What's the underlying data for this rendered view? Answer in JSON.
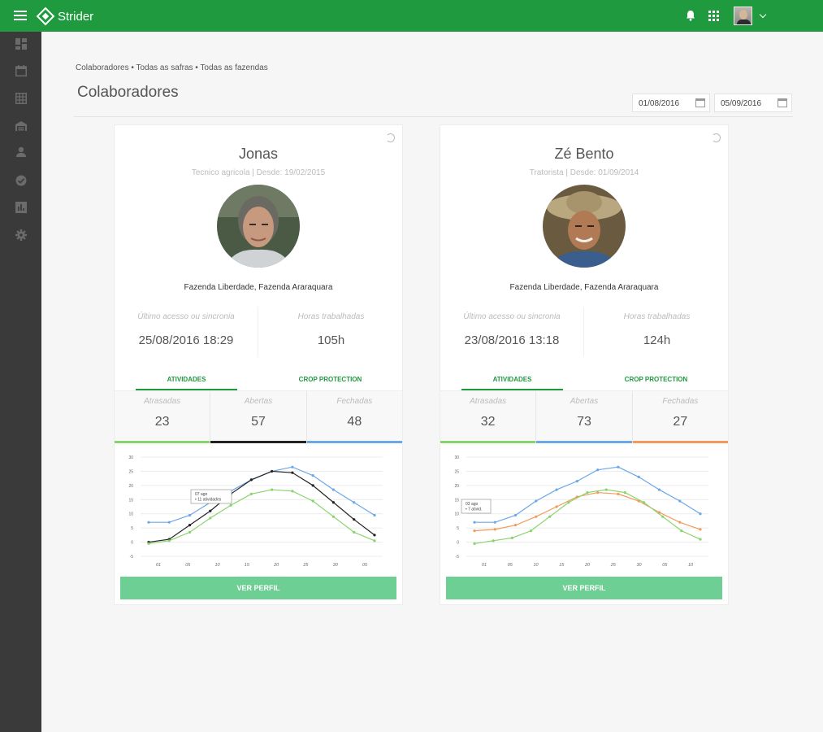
{
  "app": {
    "name": "Strider"
  },
  "breadcrumb": "Colaboradores • Todas as safras • Todas as fazendas",
  "page_title": "Colaboradores",
  "date_from": "01/08/2016",
  "date_to": "05/09/2016",
  "sidebar": [
    "dashboard-icon",
    "calendar-icon",
    "grid-icon",
    "warehouse-icon",
    "person-icon",
    "check-circle-icon",
    "report-icon",
    "gear-icon"
  ],
  "colors": {
    "green": "#1f9a3f",
    "sidebar": "#3a3a3a",
    "blue": "#6aa8e8",
    "lime": "#88d46b",
    "black": "#222222",
    "orange": "#f39a5b"
  },
  "cards": [
    {
      "name": "Jonas",
      "role": "Tecnico agricola  | Desde: 19/02/2015",
      "farms": "Fazenda Liberdade, Fazenda Araraquara",
      "last_access_label": "Último acesso ou sincronia",
      "last_access": "25/08/2016 18:29",
      "hours_label": "Horas trabalhadas",
      "hours": "105h",
      "tab_activities": "ATIVIDADES",
      "tab_crop": "CROP PROTECTION",
      "late_label": "Atrasadas",
      "late": "23",
      "open_label": "Abertas",
      "open": "57",
      "closed_label": "Fechadas",
      "closed": "48",
      "button": "VER PERFIL"
    },
    {
      "name": "Zé Bento",
      "role": "Tratorista  | Desde: 01/09/2014",
      "farms": "Fazenda Liberdade, Fazenda Araraquara",
      "last_access_label": "Último acesso ou sincronia",
      "last_access": "23/08/2016 13:18",
      "hours_label": "Horas trabalhadas",
      "hours": "124h",
      "tab_activities": "ATIVIDADES",
      "tab_crop": "CROP PROTECTION",
      "late_label": "Atrasadas",
      "late": "32",
      "open_label": "Abertas",
      "open": "73",
      "closed_label": "Fechadas",
      "closed": "27",
      "button": "VER PERFIL"
    }
  ],
  "chart_data": [
    {
      "type": "line",
      "x": [
        "01",
        "05",
        "10",
        "15",
        "20",
        "25",
        "30",
        "05"
      ],
      "yticks": [
        "30",
        "25",
        "20",
        "15",
        "10",
        "5",
        "0",
        "-5"
      ],
      "ylim": [
        -5,
        30
      ],
      "series": [
        {
          "color": "#6aa8e8",
          "values": [
            7,
            7,
            9.5,
            14,
            18,
            22,
            25,
            26.5,
            23.5,
            18.5,
            14,
            9.5
          ]
        },
        {
          "color": "#222222",
          "values": [
            0,
            1,
            6,
            11,
            17,
            22,
            25,
            24.5,
            20,
            14,
            8,
            2.5
          ]
        },
        {
          "color": "#88d46b",
          "values": [
            -0.5,
            0.5,
            3.5,
            8.5,
            13,
            17,
            18.5,
            18,
            14.5,
            9,
            3.5,
            0.5
          ]
        }
      ],
      "tooltip": {
        "line1": "07 ago",
        "line2": "• 11 atividades"
      }
    },
    {
      "type": "line",
      "x": [
        "01",
        "05",
        "10",
        "15",
        "20",
        "25",
        "30",
        "05",
        "10"
      ],
      "yticks": [
        "30",
        "25",
        "20",
        "15",
        "10",
        "5",
        "0",
        "-5"
      ],
      "ylim": [
        -5,
        30
      ],
      "series": [
        {
          "color": "#6aa8e8",
          "values": [
            7,
            7,
            9.5,
            14.5,
            18.5,
            21.5,
            25.5,
            26.5,
            23,
            18.5,
            14.5,
            10
          ]
        },
        {
          "color": "#f39a5b",
          "values": [
            4,
            4.5,
            6,
            9,
            12.5,
            16,
            17.5,
            17,
            14.5,
            10.5,
            7,
            4.5
          ]
        },
        {
          "color": "#88d46b",
          "values": [
            -0.5,
            0.5,
            1.5,
            4,
            9,
            14,
            17.5,
            18.5,
            17.5,
            14,
            9,
            4,
            1
          ]
        }
      ],
      "tooltip": {
        "line1": "03 ago",
        "line2": "• 7 ativid."
      }
    }
  ]
}
